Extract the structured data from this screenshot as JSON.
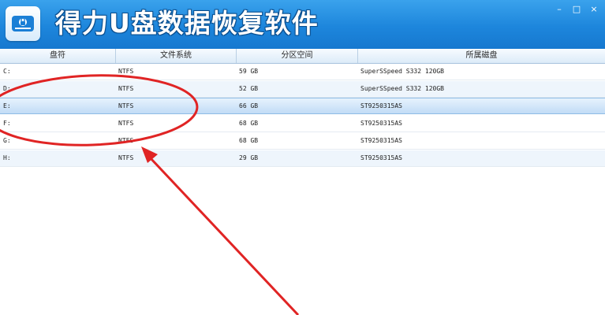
{
  "window": {
    "title": "得力U盘数据恢复软件",
    "minimize_glyph": "–",
    "maximize_glyph": "□",
    "close_glyph": "×"
  },
  "table": {
    "columns": [
      "盘符",
      "文件系统",
      "分区空间",
      "所属磁盘"
    ],
    "rows": [
      {
        "drive": "C:",
        "fs": "NTFS",
        "size": "59 GB",
        "disk": "SuperSSpeed S332 120GB"
      },
      {
        "drive": "D:",
        "fs": "NTFS",
        "size": "52 GB",
        "disk": "SuperSSpeed S332 120GB"
      },
      {
        "drive": "E:",
        "fs": "NTFS",
        "size": "66 GB",
        "disk": "ST9250315AS"
      },
      {
        "drive": "F:",
        "fs": "NTFS",
        "size": "68 GB",
        "disk": "ST9250315AS"
      },
      {
        "drive": "G:",
        "fs": "NTFS",
        "size": "68 GB",
        "disk": "ST9250315AS"
      },
      {
        "drive": "H:",
        "fs": "NTFS",
        "size": "29 GB",
        "disk": "ST9250315AS"
      }
    ],
    "selected_row": 2
  },
  "annotation": {
    "color": "#e02424"
  },
  "colors": {
    "titlebar": "#1d86dc",
    "selection": "#c2dcf6"
  }
}
